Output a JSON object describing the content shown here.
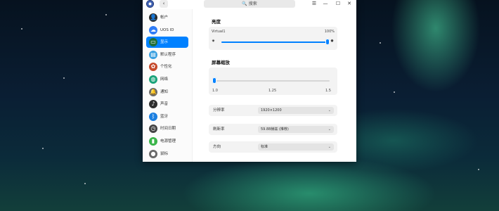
{
  "titlebar": {
    "search_placeholder": "搜索",
    "back_glyph": "‹",
    "search_glyph": "🔍",
    "controls": {
      "menu": "☰",
      "minimize": "—",
      "maximize": "☐",
      "close": "✕"
    }
  },
  "sidebar": {
    "items": [
      {
        "label": "帐户",
        "icon": "user-icon",
        "glyph": "👤",
        "color": "#2b2b2b"
      },
      {
        "label": "UOS ID",
        "icon": "cloud-icon",
        "glyph": "☁",
        "color": "#2f7cf6"
      },
      {
        "label": "显示",
        "icon": "display-icon",
        "glyph": "▭",
        "color": "#1f6f3a",
        "active": true
      },
      {
        "label": "默认程序",
        "icon": "default-apps-icon",
        "glyph": "▤",
        "color": "#3aa0e0"
      },
      {
        "label": "个性化",
        "icon": "personalization-icon",
        "glyph": "✿",
        "color": "#c64a2b"
      },
      {
        "label": "网络",
        "icon": "network-icon",
        "glyph": "◍",
        "color": "#1aa37a"
      },
      {
        "label": "通知",
        "icon": "notification-icon",
        "glyph": "🔔",
        "color": "#6b6b6b"
      },
      {
        "label": "声音",
        "icon": "sound-icon",
        "glyph": "♪",
        "color": "#2e2e2e"
      },
      {
        "label": "蓝牙",
        "icon": "bluetooth-icon",
        "glyph": "ᛒ",
        "color": "#1b7fe0"
      },
      {
        "label": "时间日期",
        "icon": "clock-icon",
        "glyph": "◷",
        "color": "#444444"
      },
      {
        "label": "电源管理",
        "icon": "battery-icon",
        "glyph": "▮",
        "color": "#3ab54a"
      },
      {
        "label": "鼠标",
        "icon": "mouse-icon",
        "glyph": "●",
        "color": "#6a6a6a"
      }
    ]
  },
  "brightness": {
    "title": "亮度",
    "monitor": "Virtual1",
    "value_label": "100%",
    "value": 1.0,
    "low_icon": "✷",
    "high_icon": "✸"
  },
  "scaling": {
    "title": "屏幕缩放",
    "ticks": [
      "1.0",
      "1.25",
      "1.5"
    ],
    "value": 1.0
  },
  "settings": [
    {
      "label": "分辨率",
      "value": "1920×1200"
    },
    {
      "label": "刷新率",
      "value": "59.88赫兹 (推荐)"
    },
    {
      "label": "方向",
      "value": "标准"
    }
  ],
  "dropdown_glyph": "⌄",
  "colors": {
    "accent": "#0081ff",
    "active_bg": "#0081ff"
  }
}
